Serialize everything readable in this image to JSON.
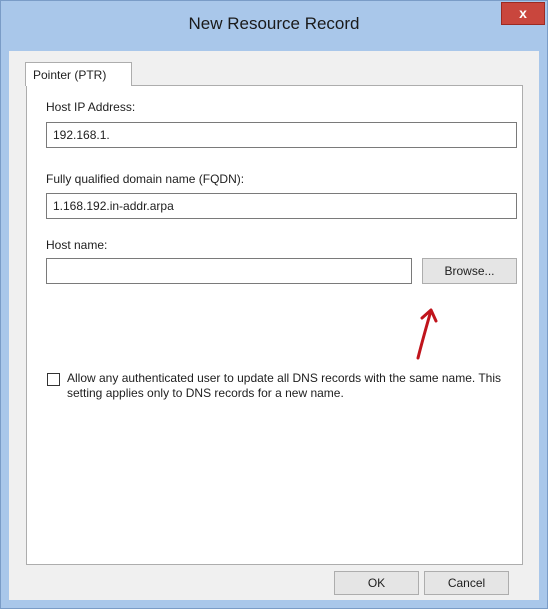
{
  "window": {
    "title": "New Resource Record",
    "close_glyph": "x"
  },
  "tab": {
    "label": "Pointer (PTR)"
  },
  "host_ip": {
    "label": "Host IP Address:",
    "value": "192.168.1."
  },
  "fqdn": {
    "label": "Fully qualified domain name (FQDN):",
    "value": "1.168.192.in-addr.arpa"
  },
  "host_name": {
    "label": "Host name:",
    "value": "",
    "browse_label": "Browse..."
  },
  "allow_update": {
    "checked": false,
    "text": "Allow any authenticated user to update all DNS records with the same name. This setting applies only to DNS records for a new name."
  },
  "buttons": {
    "ok": "OK",
    "cancel": "Cancel"
  },
  "colors": {
    "titlebar": "#a9c7ea",
    "close": "#c9463d",
    "annotation_arrow": "#c0141c"
  },
  "icons": {
    "annotation": "red-arrow-icon"
  }
}
